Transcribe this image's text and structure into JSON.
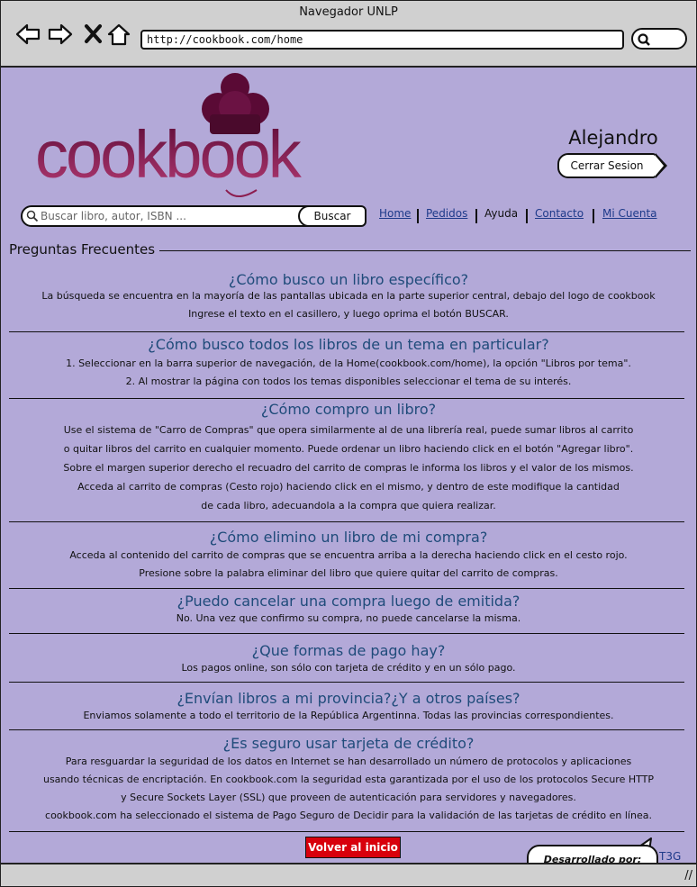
{
  "browser": {
    "title": "Navegador UNLP",
    "url": "http://cookbook.com/home",
    "nav_icons": [
      "back-arrow-icon",
      "forward-arrow-icon",
      "stop-icon",
      "home-icon"
    ]
  },
  "brand": {
    "logo_text": "cookbook",
    "colors": {
      "logo": "#8c1d4f",
      "hat": "#5a0a35",
      "background": "#b3a9d8",
      "link": "#1e3a8a",
      "heading": "#1f4b7a",
      "back_button": "#d8000c"
    }
  },
  "user": {
    "name": "Alejandro",
    "logout_label": "Cerrar Sesion"
  },
  "search": {
    "placeholder": "Buscar libro, autor, ISBN ...",
    "button_label": "Buscar"
  },
  "nav": {
    "home": "Home",
    "orders": "Pedidos",
    "help": "Ayuda",
    "contact": "Contacto",
    "account": "Mi Cuenta"
  },
  "faq": {
    "title": "Preguntas Frecuentes",
    "items": [
      {
        "q": "¿Cómo busco un libro específico?",
        "a": [
          "La búsqueda se encuentra en la mayoría de las pantallas ubicada en la parte superior central, debajo del logo de cookbook",
          "Ingrese el texto en el casillero, y luego oprima el botón BUSCAR."
        ]
      },
      {
        "q": "¿Cómo busco todos los libros de un tema en particular?",
        "a": [
          "1. Seleccionar en la barra superior de navegación, de la Home(cookbook.com/home), la opción \"Libros por tema\".",
          "2. Al mostrar la página con todos los temas disponibles seleccionar el tema de su interés."
        ]
      },
      {
        "q": "¿Cómo compro un libro?",
        "a": [
          "Use el sistema de \"Carro de Compras\" que opera similarmente al de una librería real, puede sumar libros al carrito",
          "o quitar libros del carrito en cualquier momento. Puede ordenar un libro haciendo click en el botón \"Agregar libro\".",
          "Sobre el margen superior derecho el recuadro del carrito de compras le informa los libros y el valor de los mismos.",
          "Acceda al carrito de compras (Cesto rojo) haciendo click en el mismo, y dentro de este modifique la cantidad",
          "de cada libro, adecuandola a la compra que quiera realizar."
        ]
      },
      {
        "q": "¿Cómo elimino un libro de mi compra?",
        "a": [
          "Acceda al contenido del carrito de compras que se encuentra arriba a la derecha haciendo click en el cesto rojo.",
          "Presione sobre la palabra eliminar del libro que quiere quitar del carrito de compras."
        ]
      },
      {
        "q": "¿Puedo cancelar una compra luego de emitida?",
        "a": [
          "No. Una vez que confirmo su compra, no puede cancelarse la misma."
        ]
      },
      {
        "q": "¿Que formas de pago hay?",
        "a": [
          "Los pagos online, son sólo con tarjeta de crédito y en un sólo pago."
        ]
      },
      {
        "q": "¿Envían libros a mi provincia?¿Y a otros países?",
        "a": [
          "Enviamos solamente a todo el territorio de la República Argentinna. Todas las provincias correspondientes."
        ]
      },
      {
        "q": "¿Es seguro usar tarjeta de crédito?",
        "a": [
          "Para resguardar la seguridad de los datos en Internet se han desarrollado un número de protocolos y aplicaciones",
          "usando técnicas de encriptación. En cookbook.com la seguridad esta garantizada por el uso de los protocolos Secure HTTP",
          "y Secure Sockets Layer (SSL) que proveen de autenticación para servidores y navegadores.",
          "cookbook.com ha seleccionado el sistema de Pago Seguro de Decidir para la validación de las tarjetas de crédito en línea."
        ]
      }
    ]
  },
  "footer": {
    "back_label": "Volver al inicio",
    "developed_by": "Desarrollado por:",
    "developer": "T3G"
  }
}
